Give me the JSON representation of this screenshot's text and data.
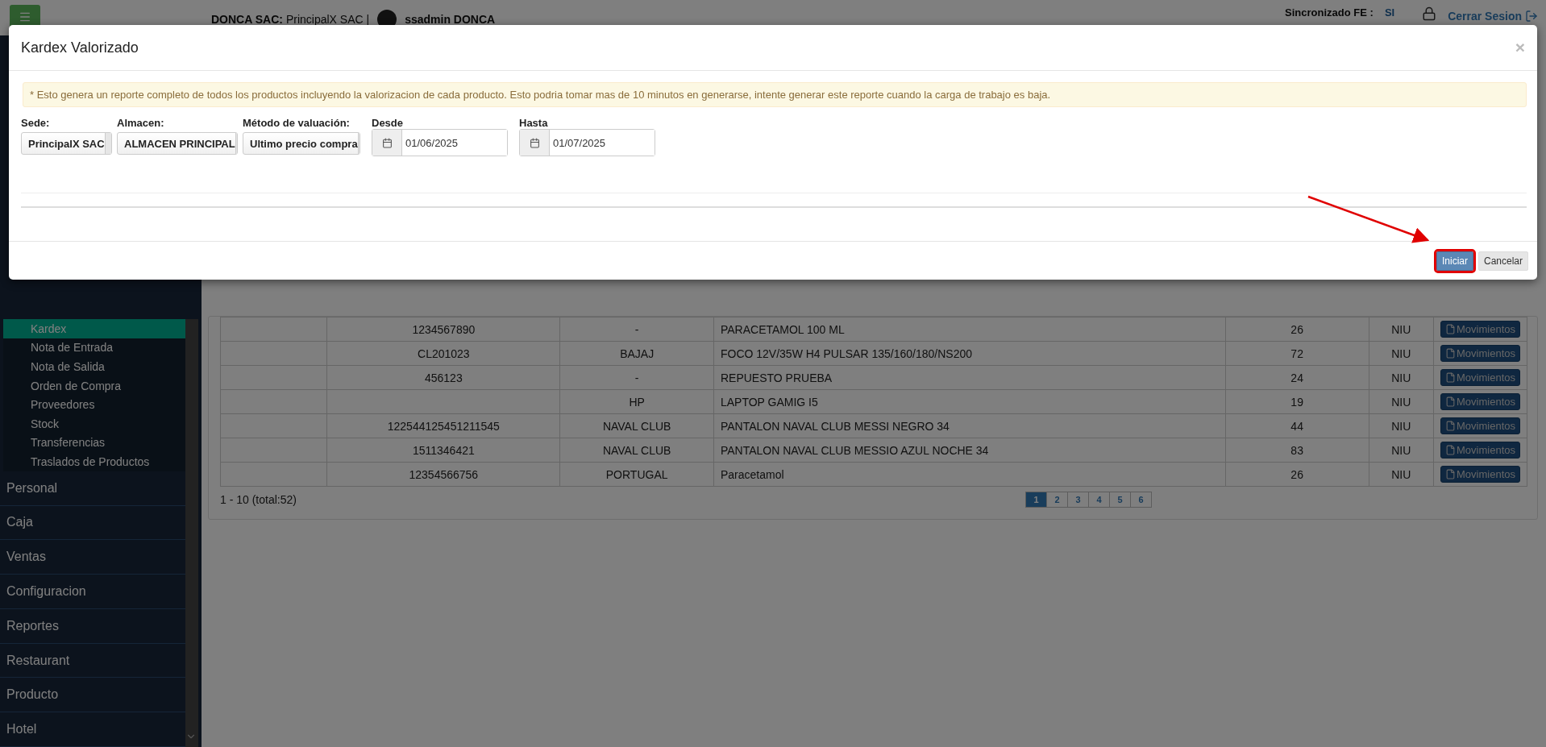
{
  "header": {
    "company": "DONCA SAC:",
    "branch": "PrincipalX SAC |",
    "user": "ssadmin DONCA",
    "sync_label": "Sincronizado FE :",
    "sync_value": "SI",
    "logout": "Cerrar Sesion"
  },
  "sidebar": {
    "submenu": [
      {
        "label": "Kardex",
        "selected": true
      },
      {
        "label": "Nota de Entrada",
        "selected": false
      },
      {
        "label": "Nota de Salida",
        "selected": false
      },
      {
        "label": "Orden de Compra",
        "selected": false
      },
      {
        "label": "Proveedores",
        "selected": false
      },
      {
        "label": "Stock",
        "selected": false
      },
      {
        "label": "Transferencias",
        "selected": false
      },
      {
        "label": "Traslados de Productos",
        "selected": false
      }
    ],
    "menu": [
      "Personal",
      "Caja",
      "Ventas",
      "Configuracion",
      "Reportes",
      "Restaurant",
      "Producto",
      "Hotel"
    ]
  },
  "table": {
    "rows": [
      {
        "cells": [
          "",
          "1234567890",
          "-",
          "PARACETAMOL 100 ML",
          "26",
          "NIU"
        ],
        "action": "Movimientos"
      },
      {
        "cells": [
          "",
          "CL201023",
          "BAJAJ",
          "FOCO 12V/35W H4 PULSAR 135/160/180/NS200",
          "72",
          "NIU"
        ],
        "action": "Movimientos"
      },
      {
        "cells": [
          "",
          "456123",
          "-",
          "REPUESTO PRUEBA",
          "24",
          "NIU"
        ],
        "action": "Movimientos"
      },
      {
        "cells": [
          "",
          "",
          "HP",
          "LAPTOP GAMIG I5",
          "19",
          "NIU"
        ],
        "action": "Movimientos"
      },
      {
        "cells": [
          "",
          "122544125451211545",
          "NAVAL CLUB",
          "PANTALON NAVAL CLUB MESSI NEGRO 34",
          "44",
          "NIU"
        ],
        "action": "Movimientos"
      },
      {
        "cells": [
          "",
          "1511346421",
          "NAVAL CLUB",
          "PANTALON NAVAL CLUB MESSIO AZUL NOCHE 34",
          "83",
          "NIU"
        ],
        "action": "Movimientos"
      },
      {
        "cells": [
          "",
          "12354566756",
          "PORTUGAL",
          "Paracetamol",
          "26",
          "NIU"
        ],
        "action": "Movimientos"
      }
    ]
  },
  "pagination": {
    "summary": "1 - 10 (total:52)",
    "pages": [
      {
        "label": "1",
        "selected": true
      },
      {
        "label": "2",
        "selected": false
      },
      {
        "label": "3",
        "selected": false
      },
      {
        "label": "4",
        "selected": false
      },
      {
        "label": "5",
        "selected": false
      },
      {
        "label": "6",
        "selected": false
      }
    ]
  },
  "modal": {
    "title": "Kardex Valorizado",
    "close": "×",
    "notice": "* Esto genera un reporte completo de todos los productos incluyendo la valorizacion de cada producto. Esto podria tomar mas de 10 minutos en generarse, intente generar este reporte cuando la carga de trabajo es baja.",
    "fields": [
      {
        "kind": "select",
        "label": "Sede:",
        "value": "PrincipalX SAC"
      },
      {
        "kind": "select",
        "label": "Almacen:",
        "value": "ALMACEN PRINCIPAL"
      },
      {
        "kind": "select",
        "label": "Método de valuación:",
        "value": "Ultimo precio compra"
      },
      {
        "kind": "date",
        "label": "Desde",
        "value": "01/06/2025"
      },
      {
        "kind": "date",
        "label": "Hasta",
        "value": "01/07/2025"
      }
    ],
    "buttons": [
      {
        "label": "Iniciar",
        "kind": "primary",
        "highlighted": true
      },
      {
        "label": "Cancelar",
        "kind": "default",
        "highlighted": false
      }
    ]
  }
}
